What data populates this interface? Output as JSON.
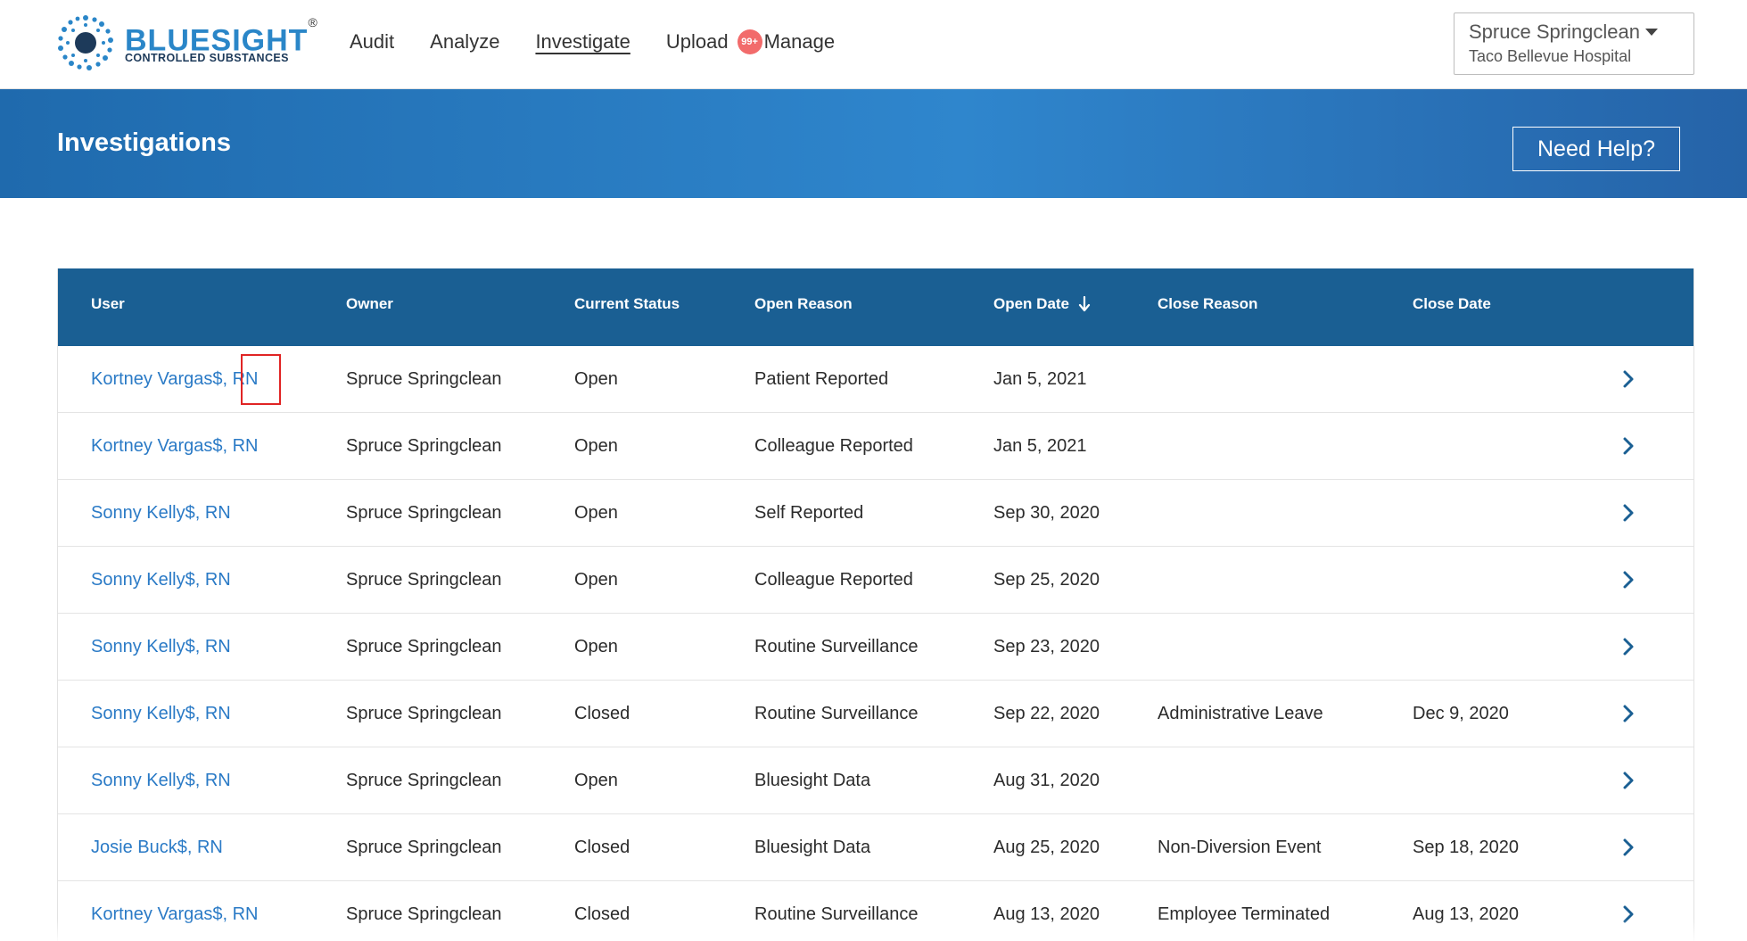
{
  "brand": {
    "name": "BLUESIGHT",
    "registered": "®",
    "tagline": "CONTROLLED SUBSTANCES",
    "primary_color": "#2a86c8"
  },
  "nav": {
    "items": [
      {
        "label": "Audit",
        "active": false
      },
      {
        "label": "Analyze",
        "active": false
      },
      {
        "label": "Investigate",
        "active": true
      },
      {
        "label": "Upload",
        "active": false
      },
      {
        "label": "Manage",
        "active": false
      }
    ],
    "upload_badge": "99+"
  },
  "account": {
    "user": "Spruce Springclean",
    "facility": "Taco Bellevue Hospital"
  },
  "banner": {
    "title": "Investigations",
    "help_label": "Need Help?"
  },
  "table": {
    "columns": [
      "User",
      "Owner",
      "Current Status",
      "Open Reason",
      "Open Date",
      "Close Reason",
      "Close Date"
    ],
    "sorted_column": "Open Date",
    "sort_direction": "descending",
    "rows": [
      {
        "user": "Kortney Vargas$, RN",
        "owner": "Spruce Springclean",
        "status": "Open",
        "open_reason": "Patient Reported",
        "open_date": "Jan 5, 2021",
        "close_reason": "",
        "close_date": ""
      },
      {
        "user": "Kortney Vargas$, RN",
        "owner": "Spruce Springclean",
        "status": "Open",
        "open_reason": "Colleague Reported",
        "open_date": "Jan 5, 2021",
        "close_reason": "",
        "close_date": ""
      },
      {
        "user": "Sonny Kelly$, RN",
        "owner": "Spruce Springclean",
        "status": "Open",
        "open_reason": "Self Reported",
        "open_date": "Sep 30, 2020",
        "close_reason": "",
        "close_date": ""
      },
      {
        "user": "Sonny Kelly$, RN",
        "owner": "Spruce Springclean",
        "status": "Open",
        "open_reason": "Colleague Reported",
        "open_date": "Sep 25, 2020",
        "close_reason": "",
        "close_date": ""
      },
      {
        "user": "Sonny Kelly$, RN",
        "owner": "Spruce Springclean",
        "status": "Open",
        "open_reason": "Routine Surveillance",
        "open_date": "Sep 23, 2020",
        "close_reason": "",
        "close_date": ""
      },
      {
        "user": "Sonny Kelly$, RN",
        "owner": "Spruce Springclean",
        "status": "Closed",
        "open_reason": "Routine Surveillance",
        "open_date": "Sep 22, 2020",
        "close_reason": "Administrative Leave",
        "close_date": "Dec 9, 2020"
      },
      {
        "user": "Sonny Kelly$, RN",
        "owner": "Spruce Springclean",
        "status": "Open",
        "open_reason": "Bluesight Data",
        "open_date": "Aug 31, 2020",
        "close_reason": "",
        "close_date": ""
      },
      {
        "user": "Josie Buck$, RN",
        "owner": "Spruce Springclean",
        "status": "Closed",
        "open_reason": "Bluesight Data",
        "open_date": "Aug 25, 2020",
        "close_reason": "Non-Diversion Event",
        "close_date": "Sep 18, 2020"
      },
      {
        "user": "Kortney Vargas$, RN",
        "owner": "Spruce Springclean",
        "status": "Closed",
        "open_reason": "Routine Surveillance",
        "open_date": "Aug 13, 2020",
        "close_reason": "Employee Terminated",
        "close_date": "Aug 13, 2020"
      }
    ]
  },
  "colors": {
    "header_blue": "#1a5f93",
    "banner_blue": "#2f86cd",
    "link_blue": "#2a7ac6",
    "highlight_red": "#e02424",
    "badge_red": "#f26b6b"
  }
}
